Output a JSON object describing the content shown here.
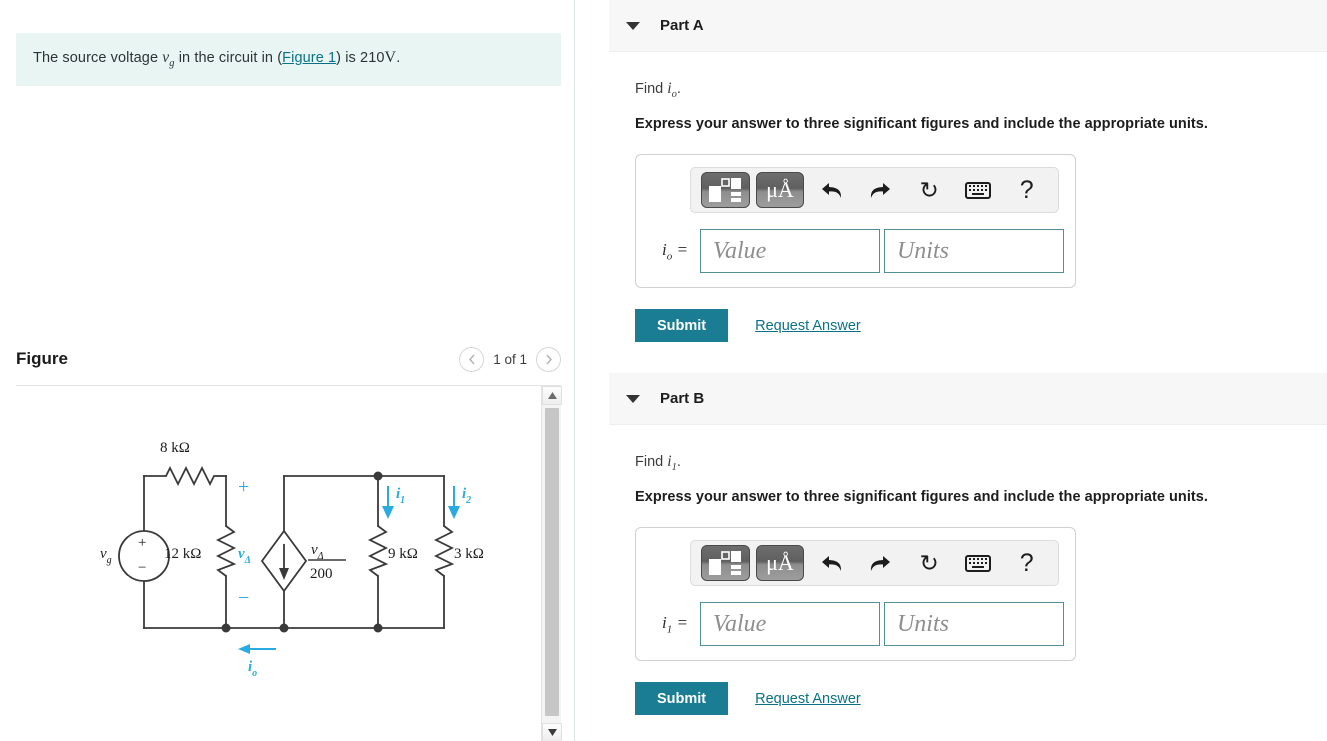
{
  "problem": {
    "text_before": "The source voltage ",
    "var_v": "v",
    "var_v_sub": "g",
    "text_mid": " in the circuit in (",
    "figure_link": "Figure 1",
    "text_after": ") is 210",
    "unit": "V",
    "period": "."
  },
  "figure": {
    "title": "Figure",
    "pager_label": "1 of 1",
    "prev_icon": "chevron-left-icon",
    "next_icon": "chevron-right-icon",
    "scroll_up_icon": "triangle-up-icon",
    "scroll_down_icon": "triangle-down-icon"
  },
  "circuit": {
    "source_label": "v",
    "source_label_sub": "g",
    "source_plus": "+",
    "source_minus": "−",
    "r_series": "8 kΩ",
    "r_parallel": "12 kΩ",
    "v_delta": "v",
    "v_delta_sub": "Δ",
    "polarity_plus": "+",
    "polarity_minus": "−",
    "dep_source_num": "v",
    "dep_source_num_sub": "Δ",
    "dep_source_den": "200",
    "r_9k": "9 kΩ",
    "r_3k": "3 kΩ",
    "i1": "i",
    "i1_sub": "1",
    "i2": "i",
    "i2_sub": "2",
    "io": "i",
    "io_sub": "o",
    "accent_color": "#29abe2"
  },
  "toolbar": {
    "template_icon": "math-template-icon",
    "units_icon": "micro-angstrom-units-icon",
    "undo_icon": "undo-arrow-icon",
    "redo_icon": "redo-arrow-icon",
    "reset_icon": "reset-circular-arrow-icon",
    "keyboard_icon": "keyboard-icon",
    "help_icon": "question-mark-icon",
    "units_text": "μÅ",
    "undo_glyph": "⮌",
    "redo_glyph": "⮍",
    "reset_glyph": "↻",
    "help_glyph": "?"
  },
  "parts": [
    {
      "id": "part-a",
      "header": "Part A",
      "caret_icon": "triangle-down-icon",
      "find_prefix": "Find ",
      "find_var": "i",
      "find_var_sub": "o",
      "find_suffix": ".",
      "instruction": "Express your answer to three significant figures and include the appropriate units.",
      "answer_label_var": "i",
      "answer_label_sub": "o",
      "answer_label_eq": "=",
      "value_placeholder": "Value",
      "units_placeholder": "Units",
      "value_current": "",
      "units_current": "",
      "submit_label": "Submit",
      "request_label": "Request Answer"
    },
    {
      "id": "part-b",
      "header": "Part B",
      "caret_icon": "triangle-down-icon",
      "find_prefix": "Find ",
      "find_var": "i",
      "find_var_sub": "1",
      "find_suffix": ".",
      "instruction": "Express your answer to three significant figures and include the appropriate units.",
      "answer_label_var": "i",
      "answer_label_sub": "1",
      "answer_label_eq": "=",
      "value_placeholder": "Value",
      "units_placeholder": "Units",
      "value_current": "",
      "units_current": "",
      "submit_label": "Submit",
      "request_label": "Request Answer"
    }
  ],
  "colors": {
    "banner_bg": "#e8f5f3",
    "link": "#0b7285",
    "submit_bg": "#1a7d94",
    "header_bg": "#f7f7f7",
    "circuit_accent": "#29abe2"
  }
}
